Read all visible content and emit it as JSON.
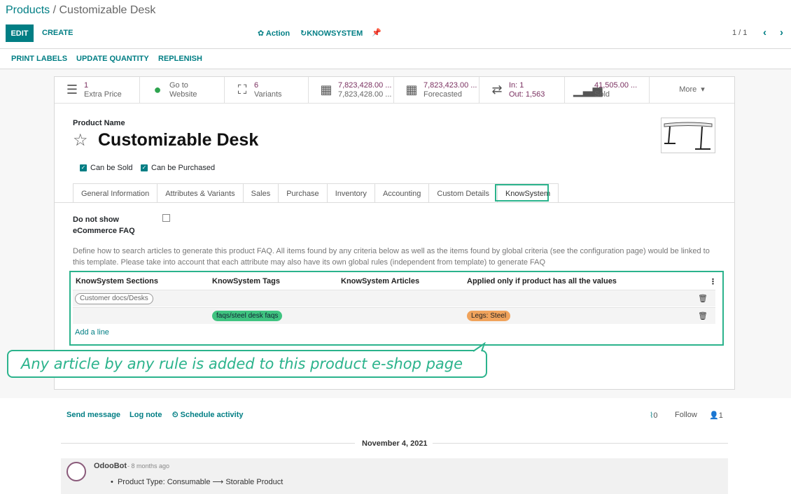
{
  "breadcrumb": {
    "parent": "Products",
    "sep": " / ",
    "current": "Customizable Desk"
  },
  "control": {
    "edit": "EDIT",
    "create": "CREATE",
    "action": "Action",
    "knowsystem": "KNOWSYSTEM",
    "pager": "1 / 1"
  },
  "toolbar": {
    "print_labels": "PRINT LABELS",
    "update_quantity": "UPDATE QUANTITY",
    "replenish": "REPLENISH"
  },
  "smart_buttons": [
    {
      "icon": "list-icon",
      "l1": "1",
      "l2": "Extra Price"
    },
    {
      "icon": "globe-icon",
      "l1": "Go to",
      "l2": "Website"
    },
    {
      "icon": "sitemap-icon",
      "l1": "6",
      "l2": "Variants"
    },
    {
      "icon": "cubes-icon",
      "l1": "7,823,428.00 ...",
      "l2": "7,823,428.00 ..."
    },
    {
      "icon": "cubes-icon",
      "l1": "7,823,423.00 ...",
      "l2": "Forecasted"
    },
    {
      "icon": "exchange-icon",
      "l1": "In:  1",
      "l2": "Out:  1,563"
    },
    {
      "icon": "signal-icon",
      "l1": "41,505.00 ...",
      "l2": "Sold"
    },
    {
      "icon": "",
      "l1": "More",
      "l2": ""
    }
  ],
  "product": {
    "name_label": "Product Name",
    "name": "Customizable Desk",
    "can_be_sold": "Can be Sold",
    "can_be_purchased": "Can be Purchased"
  },
  "tabs": [
    "General Information",
    "Attributes & Variants",
    "Sales",
    "Purchase",
    "Inventory",
    "Accounting",
    "Custom Details",
    "KnowSystem"
  ],
  "knowsystem": {
    "dns_label_1": "Do not show",
    "dns_label_2": "eCommerce FAQ",
    "description": "Define how to search articles to generate this product FAQ. All items found by any criteria below as well as the items found by global criteria (see the configuration page) would be linked to this template. Please take into account that each attribute may also have its own global rules (independent from template) to generate FAQ",
    "columns": [
      "KnowSystem Sections",
      "KnowSystem Tags",
      "KnowSystem Articles",
      "Applied only if product has all the values"
    ],
    "rows": [
      {
        "section": "Customer docs/Desks",
        "tag": "",
        "article": "",
        "values": ""
      },
      {
        "section": "",
        "tag": "faqs/steel desk faqs",
        "article": "",
        "values": "Legs: Steel"
      }
    ],
    "add_line": "Add a line"
  },
  "callout": "Any article by any rule is added to this product e-shop page",
  "chatter": {
    "send_message": "Send message",
    "log_note": "Log note",
    "schedule_activity": "Schedule activity",
    "attachments": "0",
    "follow": "Follow",
    "followers": "1",
    "date": "November 4, 2021",
    "author": "OdooBot",
    "time": "- 8 months ago",
    "message": "Product Type: Consumable ⟶ Storable Product"
  },
  "colors": {
    "accent": "#017e84",
    "highlight": "#2bb38c"
  }
}
